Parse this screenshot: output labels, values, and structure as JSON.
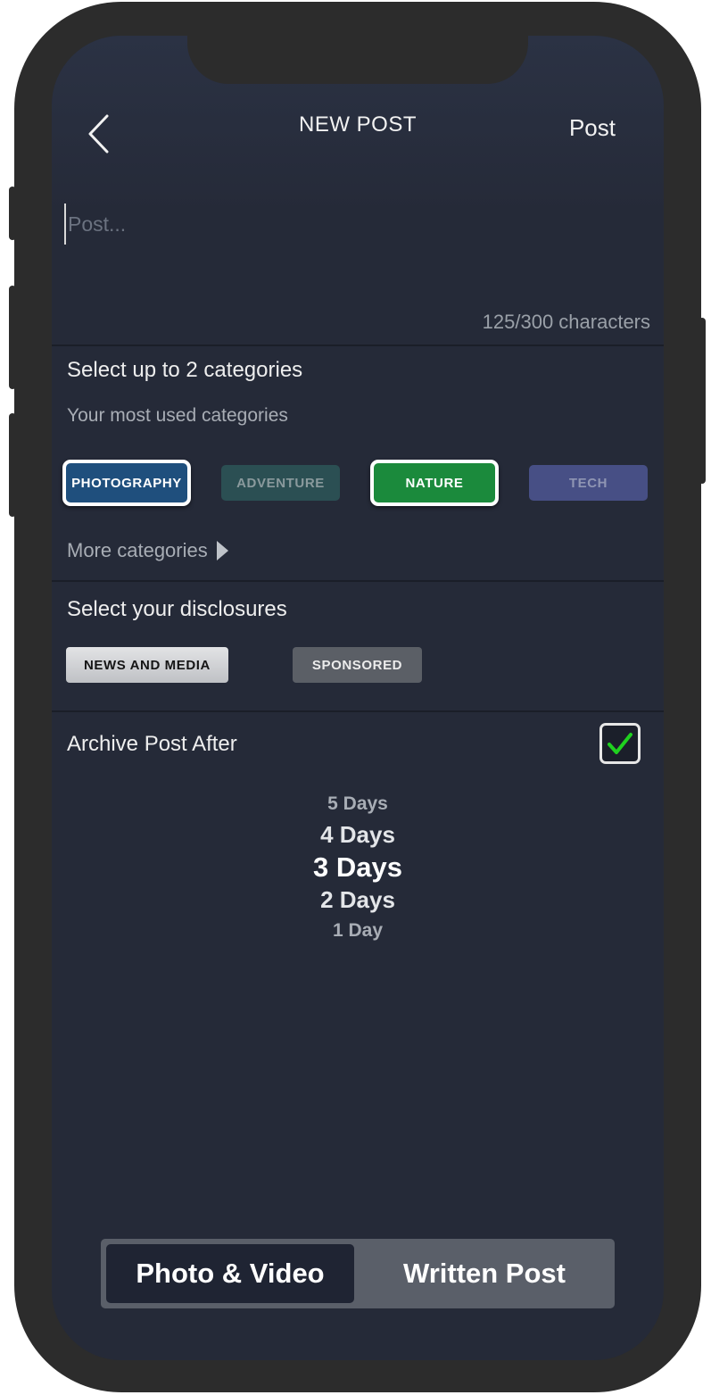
{
  "header": {
    "title": "NEW POST",
    "post_label": "Post",
    "back_icon": "chevron-left-icon"
  },
  "composer": {
    "placeholder": "Post...",
    "char_count": "125/300 characters"
  },
  "categories": {
    "title": "Select up to 2 categories",
    "subtitle": "Your most used categories",
    "chips": [
      {
        "label": "PHOTOGRAPHY",
        "selected": true,
        "color": "#1f4f7d"
      },
      {
        "label": "ADVENTURE",
        "selected": false,
        "color": "#2b4f53"
      },
      {
        "label": "NATURE",
        "selected": true,
        "color": "#1b8a3c"
      },
      {
        "label": "TECH",
        "selected": false,
        "color": "#474f85"
      }
    ],
    "more_label": "More categories",
    "more_icon": "play-triangle-icon"
  },
  "disclosures": {
    "title": "Select your disclosures",
    "chips": [
      {
        "label": "NEWS AND MEDIA",
        "selected": true
      },
      {
        "label": "SPONSORED",
        "selected": false
      }
    ]
  },
  "archive": {
    "title": "Archive Post After",
    "checked": true,
    "check_color": "#1fd11f",
    "options": [
      "5 Days",
      "4 Days",
      "3 Days",
      "2 Days",
      "1 Day"
    ],
    "selected": "3 Days"
  },
  "post_type": {
    "options": [
      "Photo & Video",
      "Written Post"
    ],
    "selected": "Photo & Video"
  }
}
